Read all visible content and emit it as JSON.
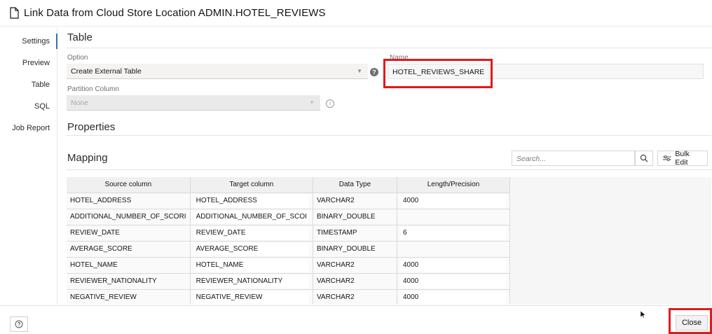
{
  "window": {
    "title": "Link Data from Cloud Store Location ADMIN.HOTEL_REVIEWS"
  },
  "icons": {
    "title": "document-icon",
    "option_help": "help-icon",
    "partition_info": "info-icon",
    "search": "search-icon",
    "bulk_edit": "sliders-icon",
    "footer_help": "question-icon"
  },
  "nav": {
    "items": [
      {
        "label": "Settings",
        "active": true
      },
      {
        "label": "Preview",
        "active": false
      },
      {
        "label": "Table",
        "active": false
      },
      {
        "label": "SQL",
        "active": false
      },
      {
        "label": "Job Report",
        "active": false
      }
    ]
  },
  "table_section": {
    "heading": "Table",
    "option_label": "Option",
    "option_value": "Create External Table",
    "partition_label": "Partition Column",
    "partition_value": "None",
    "name_label": "Name",
    "name_value": "HOTEL_REVIEWS_SHARE"
  },
  "properties_section": {
    "heading": "Properties"
  },
  "mapping_section": {
    "heading": "Mapping",
    "search_placeholder": "Search...",
    "bulk_edit_label": "Bulk Edit",
    "columns": [
      "Source column",
      "Target column",
      "Data Type",
      "Length/Precision"
    ],
    "rows": [
      [
        "HOTEL_ADDRESS",
        "HOTEL_ADDRESS",
        "VARCHAR2",
        "4000"
      ],
      [
        "ADDITIONAL_NUMBER_OF_SCORI",
        "ADDITIONAL_NUMBER_OF_SCOI",
        "BINARY_DOUBLE",
        ""
      ],
      [
        "REVIEW_DATE",
        "REVIEW_DATE",
        "TIMESTAMP",
        "6"
      ],
      [
        "AVERAGE_SCORE",
        "AVERAGE_SCORE",
        "BINARY_DOUBLE",
        ""
      ],
      [
        "HOTEL_NAME",
        "HOTEL_NAME",
        "VARCHAR2",
        "4000"
      ],
      [
        "REVIEWER_NATIONALITY",
        "REVIEWER_NATIONALITY",
        "VARCHAR2",
        "4000"
      ],
      [
        "NEGATIVE_REVIEW",
        "NEGATIVE_REVIEW",
        "VARCHAR2",
        "4000"
      ]
    ]
  },
  "footer": {
    "close_label": "Close"
  },
  "colors": {
    "accent": "#3a6fb0",
    "highlight": "#e01b1b"
  }
}
